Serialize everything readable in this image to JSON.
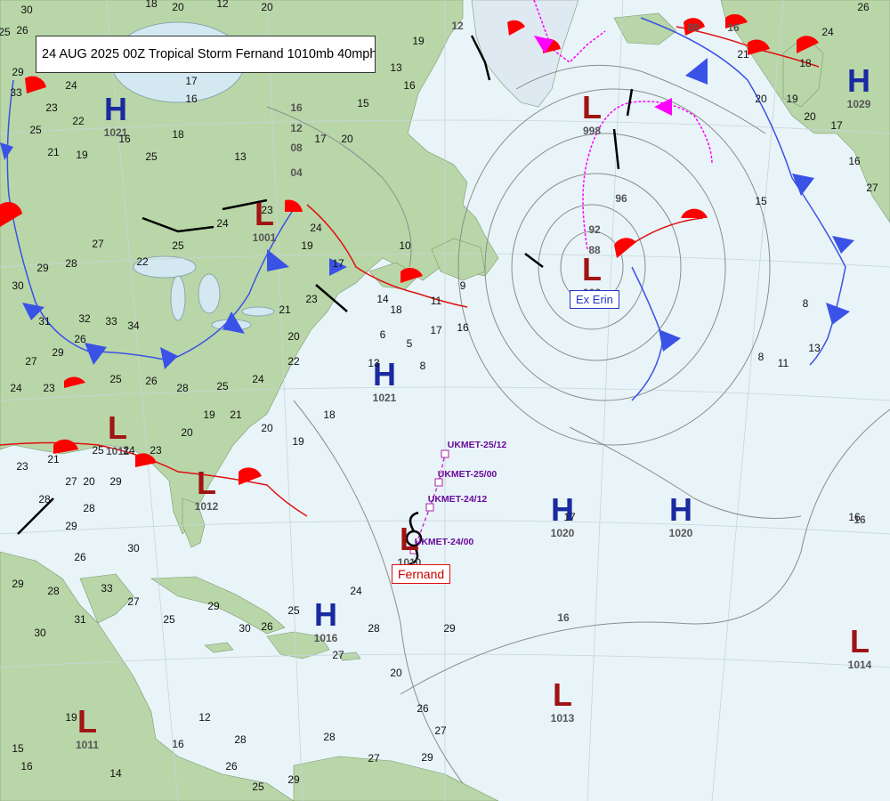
{
  "title": "24 AUG 2025 00Z Tropical Storm Fernand 1010mb 40mph",
  "storm": {
    "name": "Fernand",
    "icon": "tropical-storm-icon"
  },
  "ex_storm": {
    "label": "Ex Erin"
  },
  "colors": {
    "ocean": "#e8f4f8",
    "land": "#b9d6a8",
    "land_dark": "#a6c995",
    "high": "#1a2aa0",
    "low": "#a01414",
    "warm_front": "#e01010",
    "cold_front": "#3a52e6",
    "occluded_front": "#ff00ff",
    "isobar": "#8c8c8c",
    "track": "#cc33cc"
  },
  "pressure_centers": [
    {
      "type": "H",
      "value": "1021"
    },
    {
      "type": "H",
      "value": "1021"
    },
    {
      "type": "H",
      "value": "1020"
    },
    {
      "type": "H",
      "value": "1020"
    },
    {
      "type": "H",
      "value": "1016"
    },
    {
      "type": "H",
      "value": "1029"
    },
    {
      "type": "L",
      "value": "998"
    },
    {
      "type": "L",
      "value": "1001"
    },
    {
      "type": "L",
      "value": "988"
    },
    {
      "type": "L",
      "value": "1011"
    },
    {
      "type": "L",
      "value": "1012"
    },
    {
      "type": "L",
      "value": "1013"
    },
    {
      "type": "L",
      "value": "1014"
    },
    {
      "type": "L",
      "value": "1011"
    },
    {
      "type": "L",
      "value": "1010"
    }
  ],
  "isobar_labels": [
    "96",
    "92",
    "88",
    "16",
    "12",
    "08",
    "04",
    "16",
    "12",
    "08",
    "16",
    "16"
  ],
  "forecast_track": {
    "model": "UKMET",
    "points": [
      "UKMET-24/00",
      "UKMET-24/12",
      "UKMET-25/00",
      "UKMET-25/12"
    ]
  },
  "observations": [
    "30",
    "20",
    "18",
    "12",
    "20",
    "25",
    "26",
    "29",
    "33",
    "24",
    "23",
    "22",
    "25",
    "21",
    "19",
    "16",
    "25",
    "17",
    "16",
    "18",
    "13",
    "23",
    "24",
    "25",
    "22",
    "27",
    "28",
    "29",
    "30",
    "31",
    "32",
    "33",
    "34",
    "26",
    "29",
    "27",
    "24",
    "23",
    "25",
    "26",
    "28",
    "25",
    "24",
    "22",
    "20",
    "21",
    "23",
    "17",
    "19",
    "24",
    "20",
    "17",
    "15",
    "16",
    "19",
    "13",
    "17",
    "10",
    "14",
    "18",
    "11",
    "9",
    "6",
    "5",
    "8",
    "13",
    "16",
    "17",
    "18",
    "19",
    "20",
    "21",
    "19",
    "20",
    "23",
    "24",
    "25",
    "27",
    "28",
    "23",
    "21",
    "20",
    "29",
    "28",
    "29",
    "30",
    "33",
    "31",
    "30",
    "29",
    "28",
    "26",
    "27",
    "25",
    "29",
    "30",
    "26",
    "25",
    "27",
    "28",
    "20",
    "29",
    "29",
    "27",
    "26",
    "24",
    "27",
    "28",
    "29",
    "25",
    "26",
    "28",
    "12",
    "16",
    "14",
    "19",
    "16",
    "15",
    "17",
    "16",
    "13",
    "11",
    "8",
    "8",
    "15",
    "16",
    "17",
    "20",
    "19",
    "20",
    "21",
    "18",
    "24",
    "26",
    "27"
  ]
}
